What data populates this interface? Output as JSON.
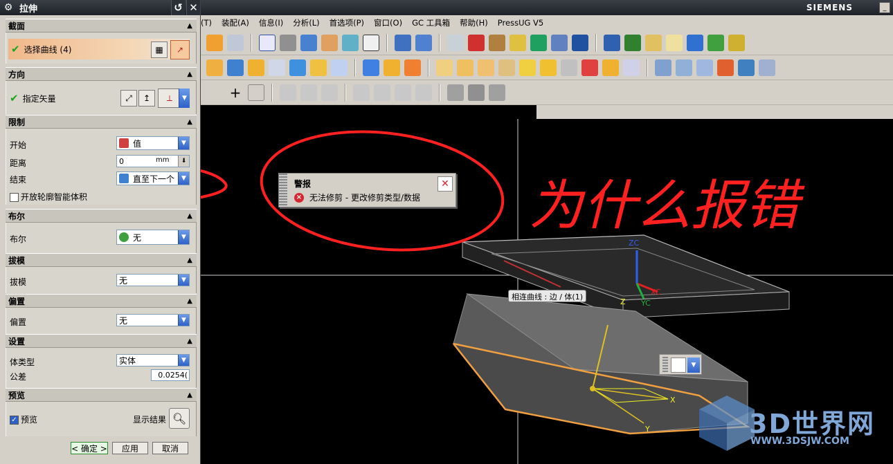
{
  "dialog": {
    "title": "拉伸",
    "sections": {
      "section": {
        "header": "截面",
        "select_curve": "选择曲线 (4)"
      },
      "direction": {
        "header": "方向",
        "specify_vector": "指定矢量"
      },
      "limits": {
        "header": "限制",
        "start_label": "开始",
        "start_value": "值",
        "distance_label": "距离",
        "distance_value": "0",
        "distance_unit": "mm",
        "end_label": "结束",
        "end_value": "直至下一个",
        "open_profile_label": "开放轮廓智能体积"
      },
      "boolean": {
        "header": "布尔",
        "label": "布尔",
        "value": "无"
      },
      "draft": {
        "header": "拔模",
        "label": "拔模",
        "value": "无"
      },
      "offset": {
        "header": "偏置",
        "label": "偏置",
        "value": "无"
      },
      "settings": {
        "header": "设置",
        "body_type_label": "体类型",
        "body_type_value": "实体",
        "tolerance_label": "公差",
        "tolerance_value": "0.0254("
      },
      "preview": {
        "header": "预览",
        "preview_label": "预览",
        "show_result_label": "显示结果"
      }
    },
    "buttons": {
      "ok": "< 确定 >",
      "apply": "应用",
      "cancel": "取消"
    }
  },
  "app": {
    "brand": "SIEMENS",
    "menu": [
      "(T)",
      "装配(A)",
      "信息(I)",
      "分析(L)",
      "首选项(P)",
      "窗口(O)",
      "GC 工具箱",
      "帮助(H)",
      "PressUG V5"
    ]
  },
  "alert": {
    "title": "警报",
    "message": "无法修剪 - 更改修剪类型/数据"
  },
  "tooltip": "相连曲线 : 边 / 体(1)",
  "axes": {
    "zc": "ZC",
    "xc": "XC",
    "yc": "YC",
    "z": "Z",
    "x": "X",
    "y": "Y"
  },
  "annotation": "为什么报错",
  "watermark": {
    "logo_text": "3D世界网",
    "url": "WWW.3DSJW.COM"
  },
  "colors": {
    "highlight_curve": "#f0a040",
    "annotation_red": "#ff2020",
    "selection_bar": "#f0b88a"
  }
}
